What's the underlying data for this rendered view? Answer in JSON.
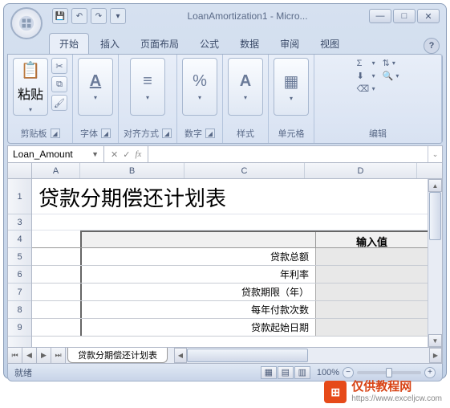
{
  "titlebar": {
    "app_title": "LoanAmortization1 - Micro..."
  },
  "tabs": {
    "items": [
      "开始",
      "插入",
      "页面布局",
      "公式",
      "数据",
      "审阅",
      "视图"
    ],
    "active": 0
  },
  "ribbon": {
    "clipboard": {
      "paste_label": "粘贴",
      "group_label": "剪贴板"
    },
    "font": {
      "group_label": "字体"
    },
    "align": {
      "group_label": "对齐方式"
    },
    "number": {
      "group_label": "数字"
    },
    "style": {
      "group_label": "样式"
    },
    "cells": {
      "group_label": "单元格"
    },
    "editing": {
      "group_label": "编辑"
    }
  },
  "formula_bar": {
    "name_box": "Loan_Amount",
    "fx_label": "fx",
    "formula": ""
  },
  "columns": [
    "A",
    "B",
    "C",
    "D"
  ],
  "rows": [
    "1",
    "3",
    "4",
    "5",
    "6",
    "7",
    "8",
    "9"
  ],
  "sheet": {
    "title_text": "贷款分期偿还计划表",
    "input_header": "输入值",
    "labels": [
      "贷款总额",
      "年利率",
      "贷款期限（年）",
      "每年付款次数",
      "贷款起始日期"
    ]
  },
  "sheet_tab": {
    "name": "贷款分期偿还计划表"
  },
  "statusbar": {
    "ready": "就绪",
    "zoom": "100%"
  },
  "watermark": {
    "title": "仅供教程网",
    "url": "https://www.exceljcw.com"
  }
}
